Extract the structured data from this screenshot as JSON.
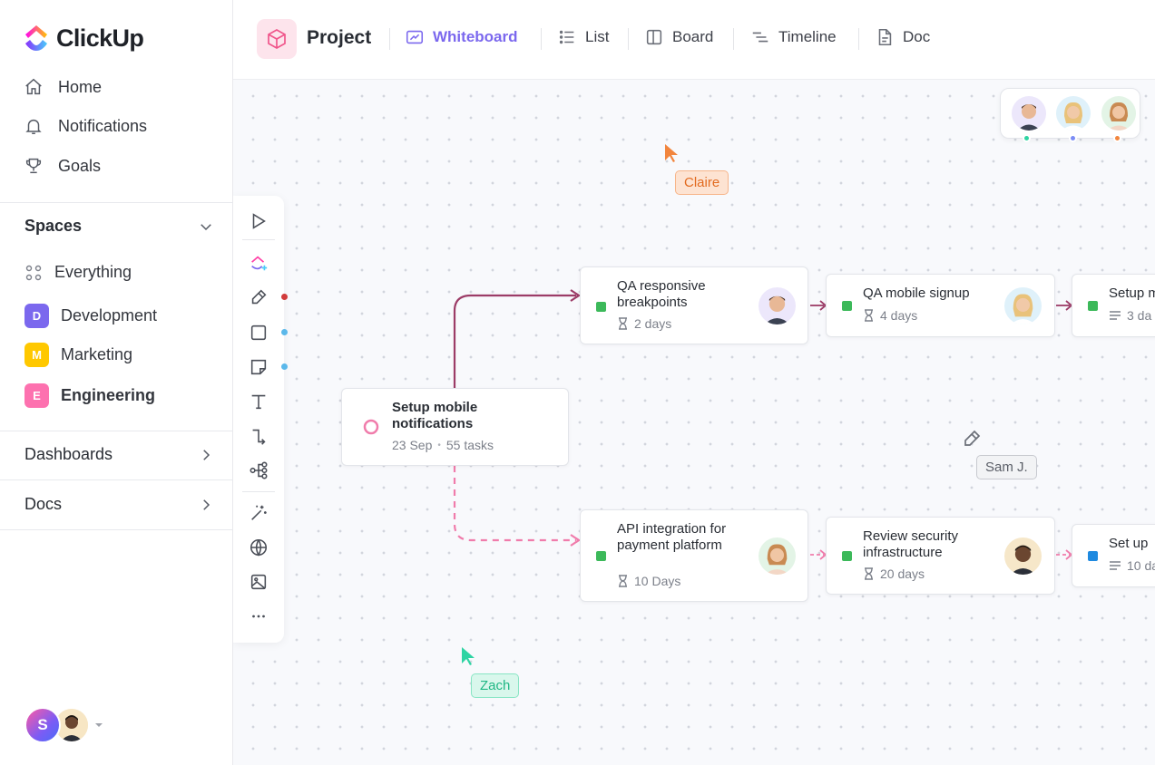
{
  "app": {
    "name": "ClickUp"
  },
  "sidebar": {
    "nav": [
      {
        "label": "Home",
        "icon": "home-icon"
      },
      {
        "label": "Notifications",
        "icon": "bell-icon"
      },
      {
        "label": "Goals",
        "icon": "trophy-icon"
      }
    ],
    "spaces": {
      "heading": "Spaces",
      "everything": "Everything",
      "items": [
        {
          "badge": "D",
          "label": "Development",
          "color": "#7b68ee"
        },
        {
          "badge": "M",
          "label": "Marketing",
          "color": "#ffc800"
        },
        {
          "badge": "E",
          "label": "Engineering",
          "color": "#fd71af"
        }
      ]
    },
    "dashboards": "Dashboards",
    "docs": "Docs",
    "user": {
      "initial": "S"
    }
  },
  "header": {
    "project": "Project",
    "tabs": [
      {
        "label": "Whiteboard",
        "active": true
      },
      {
        "label": "List"
      },
      {
        "label": "Board"
      },
      {
        "label": "Timeline"
      },
      {
        "label": "Doc"
      }
    ]
  },
  "canvas": {
    "cursors": [
      {
        "name": "Claire",
        "color": "#f2853d"
      },
      {
        "name": "Sam J.",
        "color": "#6b6f78"
      },
      {
        "name": "Zach",
        "color": "#2fd4a3"
      }
    ],
    "main_task": {
      "title": "Setup mobile notifications",
      "date": "23 Sep",
      "tasks": "55 tasks"
    },
    "top_row": [
      {
        "title": "QA responsive breakpoints",
        "meta": "2 days"
      },
      {
        "title": "QA mobile signup",
        "meta": "4 days"
      },
      {
        "title": "Setup m",
        "meta": "3 da"
      }
    ],
    "bottom_row": [
      {
        "title": "API integration for payment platform",
        "meta": "10 Days"
      },
      {
        "title": "Review security infrastructure",
        "meta": "20 days"
      },
      {
        "title": "Set up",
        "meta": "10 da"
      }
    ],
    "collaborator_dot_colors": [
      "#2fd4a3",
      "#7b8cf5",
      "#f2853d"
    ]
  }
}
